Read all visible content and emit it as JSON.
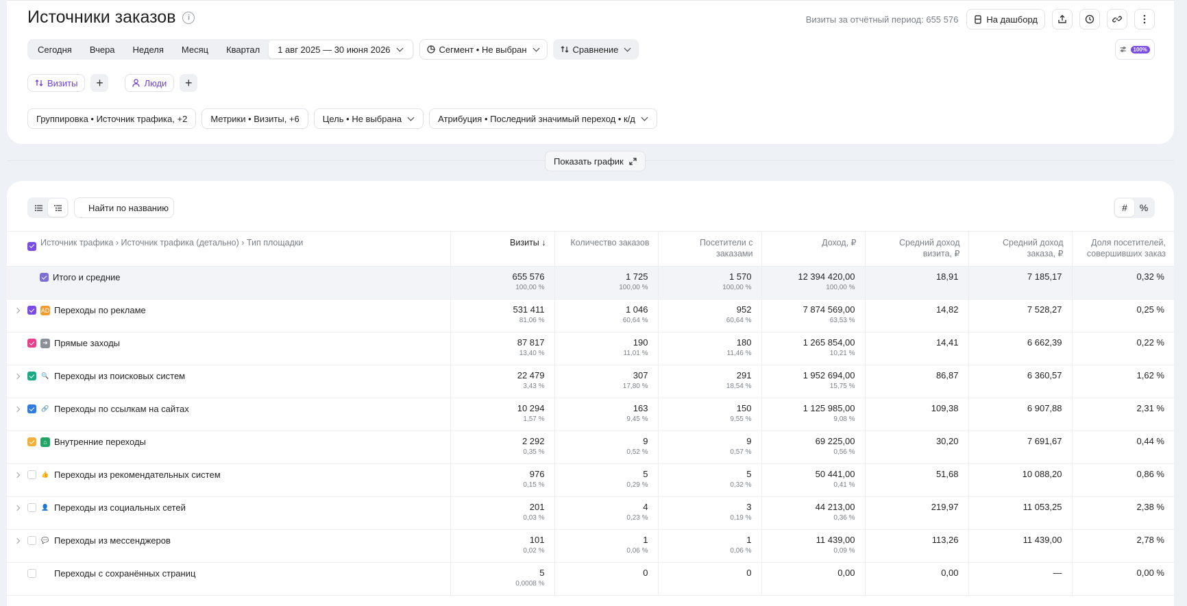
{
  "header": {
    "title": "Источники заказов",
    "visits_period": "Визиты за отчётный период: 655 576",
    "dashboard_label": "На дашборд"
  },
  "period_tabs": [
    "Сегодня",
    "Вчера",
    "Неделя",
    "Месяц",
    "Квартал"
  ],
  "date_range": "1 авг 2025 — 30 июня 2026",
  "segment": "Сегмент • Не выбран",
  "comparison": "Сравнение",
  "sampling_badge": "100%",
  "entities": {
    "visits": "Визиты",
    "people": "Люди"
  },
  "filters": {
    "grouping": "Группировка • Источник трафика, +2",
    "metrics": "Метрики • Визиты, +6",
    "goal": "Цель • Не выбрана",
    "attribution": "Атрибуция • Последний значимый переход • к/д"
  },
  "show_chart": "Показать график",
  "search": {
    "placeholder": "Найти по названию"
  },
  "unit_toggle": {
    "absolute": "#",
    "percent": "%"
  },
  "table": {
    "dimension_path": "Источник трафика › Источник трафика (детально) › Тип площадки",
    "columns": [
      "Визиты ↓",
      "Количество заказов",
      "Посетители с заказами",
      "Доход, ₽",
      "Средний доход визита, ₽",
      "Средний доход заказа, ₽",
      "Доля посетителей, совершивших заказ"
    ],
    "total": {
      "name": "Итого и средние",
      "cells": [
        {
          "v": "655 576",
          "p": "100,00 %"
        },
        {
          "v": "1 725",
          "p": "100,00 %"
        },
        {
          "v": "1 570",
          "p": "100,00 %"
        },
        {
          "v": "12 394 420,00",
          "p": "100,00 %"
        },
        {
          "v": "18,91",
          "p": ""
        },
        {
          "v": "7 185,17",
          "p": ""
        },
        {
          "v": "0,32 %",
          "p": ""
        }
      ]
    },
    "rows": [
      {
        "name": "Переходы по рекламе",
        "expandable": true,
        "checked": true,
        "color": "#7a4ce3",
        "icon": "ad-icon",
        "glyph": "AD",
        "icon_bg": "#f29a2e",
        "cells": [
          {
            "v": "531 411",
            "p": "81,06 %"
          },
          {
            "v": "1 046",
            "p": "60,64 %"
          },
          {
            "v": "952",
            "p": "60,64 %"
          },
          {
            "v": "7 874 569,00",
            "p": "63,53 %"
          },
          {
            "v": "14,82",
            "p": ""
          },
          {
            "v": "7 528,27",
            "p": ""
          },
          {
            "v": "0,25 %",
            "p": ""
          }
        ]
      },
      {
        "name": "Прямые заходы",
        "expandable": false,
        "checked": true,
        "color": "#e83e8c",
        "icon": "direct-entry-icon",
        "glyph": "➔",
        "icon_bg": "#8a8f98",
        "cells": [
          {
            "v": "87 817",
            "p": "13,40 %"
          },
          {
            "v": "190",
            "p": "11,01 %"
          },
          {
            "v": "180",
            "p": "11,46 %"
          },
          {
            "v": "1 265 854,00",
            "p": "10,21 %"
          },
          {
            "v": "14,41",
            "p": ""
          },
          {
            "v": "6 662,39",
            "p": ""
          },
          {
            "v": "0,22 %",
            "p": ""
          }
        ]
      },
      {
        "name": "Переходы из поисковых систем",
        "expandable": true,
        "checked": true,
        "color": "#1bab84",
        "icon": "search-engine-icon",
        "glyph": "🔍",
        "icon_bg": "transparent",
        "cells": [
          {
            "v": "22 479",
            "p": "3,43 %"
          },
          {
            "v": "307",
            "p": "17,80 %"
          },
          {
            "v": "291",
            "p": "18,54 %"
          },
          {
            "v": "1 952 694,00",
            "p": "15,75 %"
          },
          {
            "v": "86,87",
            "p": ""
          },
          {
            "v": "6 360,57",
            "p": ""
          },
          {
            "v": "1,62 %",
            "p": ""
          }
        ]
      },
      {
        "name": "Переходы по ссылкам на сайтах",
        "expandable": true,
        "checked": true,
        "color": "#2f7be0",
        "icon": "link-icon",
        "glyph": "🔗",
        "icon_bg": "transparent",
        "cells": [
          {
            "v": "10 294",
            "p": "1,57 %"
          },
          {
            "v": "163",
            "p": "9,45 %"
          },
          {
            "v": "150",
            "p": "9,55 %"
          },
          {
            "v": "1 125 985,00",
            "p": "9,08 %"
          },
          {
            "v": "109,38",
            "p": ""
          },
          {
            "v": "6 907,88",
            "p": ""
          },
          {
            "v": "2,31 %",
            "p": ""
          }
        ]
      },
      {
        "name": "Внутренние переходы",
        "expandable": false,
        "checked": true,
        "color": "#f2b23a",
        "icon": "home-icon",
        "glyph": "⌂",
        "icon_bg": "#21a366",
        "cells": [
          {
            "v": "2 292",
            "p": "0,35 %"
          },
          {
            "v": "9",
            "p": "0,52 %"
          },
          {
            "v": "9",
            "p": "0,57 %"
          },
          {
            "v": "69 225,00",
            "p": "0,56 %"
          },
          {
            "v": "30,20",
            "p": ""
          },
          {
            "v": "7 691,67",
            "p": ""
          },
          {
            "v": "0,44 %",
            "p": ""
          }
        ]
      },
      {
        "name": "Переходы из рекомендательных систем",
        "expandable": true,
        "checked": false,
        "color": "",
        "icon": "thumbs-up-icon",
        "glyph": "👍",
        "icon_bg": "transparent",
        "cells": [
          {
            "v": "976",
            "p": "0,15 %"
          },
          {
            "v": "5",
            "p": "0,29 %"
          },
          {
            "v": "5",
            "p": "0,32 %"
          },
          {
            "v": "50 441,00",
            "p": "0,41 %"
          },
          {
            "v": "51,68",
            "p": ""
          },
          {
            "v": "10 088,20",
            "p": ""
          },
          {
            "v": "0,86 %",
            "p": ""
          }
        ]
      },
      {
        "name": "Переходы из социальных сетей",
        "expandable": true,
        "checked": false,
        "color": "",
        "icon": "social-user-icon",
        "glyph": "👤",
        "icon_bg": "transparent",
        "cells": [
          {
            "v": "201",
            "p": "0,03 %"
          },
          {
            "v": "4",
            "p": "0,23 %"
          },
          {
            "v": "3",
            "p": "0,19 %"
          },
          {
            "v": "44 213,00",
            "p": "0,36 %"
          },
          {
            "v": "219,97",
            "p": ""
          },
          {
            "v": "11 053,25",
            "p": ""
          },
          {
            "v": "2,38 %",
            "p": ""
          }
        ]
      },
      {
        "name": "Переходы из мессенджеров",
        "expandable": true,
        "checked": false,
        "color": "",
        "icon": "chat-bubble-icon",
        "glyph": "💬",
        "icon_bg": "transparent",
        "cells": [
          {
            "v": "101",
            "p": "0,02 %"
          },
          {
            "v": "1",
            "p": "0,06 %"
          },
          {
            "v": "1",
            "p": "0,06 %"
          },
          {
            "v": "11 439,00",
            "p": "0,09 %"
          },
          {
            "v": "113,26",
            "p": ""
          },
          {
            "v": "11 439,00",
            "p": ""
          },
          {
            "v": "2,78 %",
            "p": ""
          }
        ]
      },
      {
        "name": "Переходы с сохранённых страниц",
        "expandable": false,
        "checked": false,
        "color": "",
        "icon": "saved-page-icon",
        "glyph": "▮",
        "icon_bg": "transparent",
        "cells": [
          {
            "v": "5",
            "p": "0,0008 %"
          },
          {
            "v": "0",
            "p": ""
          },
          {
            "v": "0",
            "p": ""
          },
          {
            "v": "0,00",
            "p": ""
          },
          {
            "v": "0,00",
            "p": ""
          },
          {
            "v": "—",
            "p": ""
          },
          {
            "v": "0,00 %",
            "p": ""
          }
        ]
      }
    ]
  }
}
